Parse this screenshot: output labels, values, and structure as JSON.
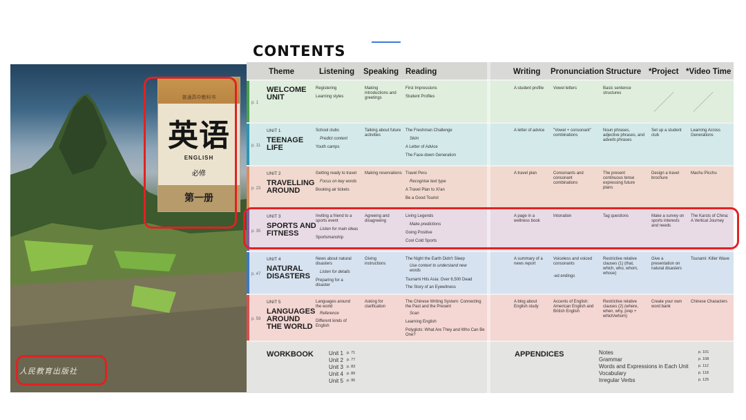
{
  "page_title": "CONTENTS",
  "cover": {
    "series_label": "普通高中教科书",
    "title_cn": "英语",
    "title_en": "ENGLISH",
    "subtitle_cn": "必修",
    "volume_cn": "第一册",
    "publisher_cn": "人民教育出版社"
  },
  "table": {
    "headers": {
      "theme": "Theme",
      "listening": "Listening",
      "speaking": "Speaking",
      "reading": "Reading",
      "writing": "Writing",
      "pronunciation": "Pronunciation",
      "structure": "Structure",
      "project": "*Project",
      "video": "*Video Time"
    },
    "rows": [
      {
        "page": "p. 1",
        "unit": "",
        "title": "WELCOME UNIT",
        "listening": [
          "Registering",
          "Learning styles"
        ],
        "speaking": "Making introductions and greetings",
        "reading": [
          "First Impressions",
          "Student Profiles"
        ],
        "writing": "A student profile",
        "pronunciation": "Vowel letters",
        "structure": "Basic sentence structures",
        "project": "",
        "video": ""
      },
      {
        "page": "p. 11",
        "unit": "UNIT 1",
        "title": "TEENAGE LIFE",
        "listening": [
          "School clubs",
          "Predict content",
          "Youth camps"
        ],
        "speaking": "Talking about future activities",
        "reading": [
          "The Freshman Challenge",
          "Skim",
          "A Letter of Advice",
          "The Face-down Generation"
        ],
        "writing": "A letter of advice",
        "pronunciation": "\"Vowel + consonant\" combinations",
        "structure": "Noun phrases, adjective phrases, and adverb phrases",
        "project": "Set up a student club",
        "video": "Learning Across Generations"
      },
      {
        "page": "p. 23",
        "unit": "UNIT 2",
        "title": "TRAVELLING AROUND",
        "listening": [
          "Getting ready to travel",
          "Focus on key words",
          "Booking air tickets"
        ],
        "speaking": "Making reservations",
        "reading": [
          "Travel Peru",
          "Recognise text type",
          "A Travel Plan to Xi'an",
          "Be a Good Tourist"
        ],
        "writing": "A travel plan",
        "pronunciation": "Consonants and consonant combinations",
        "structure": "The present continuous tense expressing future plans",
        "project": "Design a travel brochure",
        "video": "Machu Picchu"
      },
      {
        "page": "p. 35",
        "unit": "UNIT 3",
        "title": "SPORTS AND FITNESS",
        "listening": [
          "Inviting a friend to a sports event",
          "Listen for main ideas",
          "Sportsmanship"
        ],
        "speaking": "Agreeing and disagreeing",
        "reading": [
          "Living Legends",
          "Make predictions",
          "Going Positive",
          "Cool Cold Sports"
        ],
        "writing": "A page in a wellness book",
        "pronunciation": "Intonation",
        "structure": "Tag questions",
        "project": "Make a survey on sports interests and needs",
        "video": "The Karsts of China: A Vertical Journey"
      },
      {
        "page": "p. 47",
        "unit": "UNIT 4",
        "title": "NATURAL DISASTERS",
        "listening": [
          "News about natural disasters",
          "Listen for details",
          "Preparing for a disaster"
        ],
        "speaking": "Giving instructions",
        "reading": [
          "The Night the Earth Didn't Sleep",
          "Use context to understand new words",
          "Tsunami Hits Asia: Over 6,500 Dead",
          "The Story of an Eyewitness"
        ],
        "writing": "A summary of a news report",
        "pronunciation": "Voiceless and voiced consonants",
        "pronunciation_extra": "-ed endings",
        "structure": "Restrictive relative clauses (1) (that, which, who, whom, whose)",
        "project": "Give a presentation on natural disasters",
        "video": "Tsunami: Killer Wave"
      },
      {
        "page": "p. 59",
        "unit": "UNIT 5",
        "title": "LANGUAGES AROUND THE WORLD",
        "listening": [
          "Languages around the world",
          "Reference",
          "Different kinds of English"
        ],
        "speaking": "Asking for clarification",
        "reading": [
          "The Chinese Writing System: Connecting the Past and the Present",
          "Scan",
          "Learning English",
          "Polyglots: What Are They and Who Can Be One?"
        ],
        "writing": "A blog about English study",
        "pronunciation": "Accents of English: American English and British English",
        "structure": "Restrictive relative clauses (2) (where, when, why, prep + which/whom)",
        "project": "Create your own word bank",
        "video": "Chinese Characters"
      }
    ],
    "workbook": {
      "title": "WORKBOOK",
      "units": [
        {
          "unit": "Unit 1",
          "page": "p. 71"
        },
        {
          "unit": "Unit 2",
          "page": "p. 77"
        },
        {
          "unit": "Unit 3",
          "page": "p. 83"
        },
        {
          "unit": "Unit 4",
          "page": "p. 89"
        },
        {
          "unit": "Unit 5",
          "page": "p. 95"
        }
      ]
    },
    "appendices": {
      "title": "APPENDICES",
      "items": [
        {
          "name": "Notes",
          "page": "p. 101"
        },
        {
          "name": "Grammar",
          "page": "p. 108"
        },
        {
          "name": "Words and Expressions in Each Unit",
          "page": "p. 112"
        },
        {
          "name": "Vocabulary",
          "page": "p. 118"
        },
        {
          "name": "Irregular Verbs",
          "page": "p. 125"
        }
      ]
    }
  },
  "colors": {
    "highlight": "#e02222",
    "row_welcome": "#dfeedd",
    "row_unit1": "#d4e9ea",
    "row_unit2": "#f1d9cf",
    "row_unit3": "#e8dbe6",
    "row_unit4": "#d6e2f0",
    "row_unit5": "#f4d6d3",
    "workbook": "#e4e4e2"
  }
}
